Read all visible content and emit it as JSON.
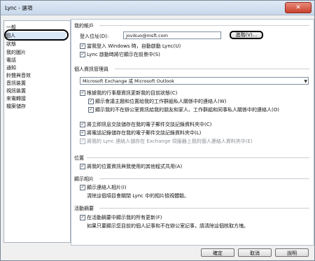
{
  "window": {
    "title": "Lync - 選項",
    "close_glyph": "✕"
  },
  "sidebar": {
    "items": [
      {
        "label": "一般"
      },
      {
        "label": "個人",
        "selected": true
      },
      {
        "label": "狀態"
      },
      {
        "label": "我的圖片"
      },
      {
        "label": "電話"
      },
      {
        "label": "通知"
      },
      {
        "label": "鈴聲與音效"
      },
      {
        "label": "音訊裝置"
      },
      {
        "label": "視訊裝置"
      },
      {
        "label": "來電轉接"
      },
      {
        "label": "檔案儲存"
      }
    ]
  },
  "account": {
    "header": "我的帳戶",
    "sign_in_label": "登入位址(D):",
    "sign_in_value": "jovikuo@msft.com",
    "settings_button": "進階(V)...",
    "auto_start": "當我登入 Windows 時，自動啟動 Lync(U)",
    "show_front": "Lync 啟動時將它顯示在前景中(S)"
  },
  "pim": {
    "header": "個人資訊管理員",
    "select_value": "Microsoft Exchange 或 Microsoft Outlook",
    "update_presence": "根據我的行事曆資訊更新我的目前狀態(C)",
    "show_meeting": "顯示會議主題和位置給我的工作群組私人關係中的連絡人(W)",
    "show_absent": "顯示我的不在辦公室資訊給我的朋友和家人、工作群組和同事私人關係中的連絡人(O)",
    "save_im": "將立即訊息交談儲存在我的電子郵件交談記錄資料夾中(C)",
    "save_calls": "將電話記錄儲存在我的電子郵件交談記錄資料夾中(L)",
    "save_contacts": "將我的 Lync 連絡人儲存在 Exchange 伺服器上我的個人連絡人資料夾中(E)"
  },
  "location": {
    "header": "位置",
    "share": "將我的位置資訊與我使用的其他程式共用(A)"
  },
  "photos": {
    "header": "顯示相片",
    "show": "顯示連絡人相片(I)",
    "note": "清除這個項目會關閉 Lync 中的相片檢視體驗。"
  },
  "feed": {
    "header": "活動摘要",
    "show": "在活動摘要中顯示我的所有更新(F)",
    "note": "如果只要顯示您目前的個人記事和不在辦公室記事，請清除這個核取方塊。"
  },
  "footer": {
    "ok": "確定",
    "cancel": "取消",
    "help": "說明"
  },
  "checkmark": "✓",
  "colors": {
    "selection": "#d9e7f7",
    "close": "#c8412c"
  }
}
